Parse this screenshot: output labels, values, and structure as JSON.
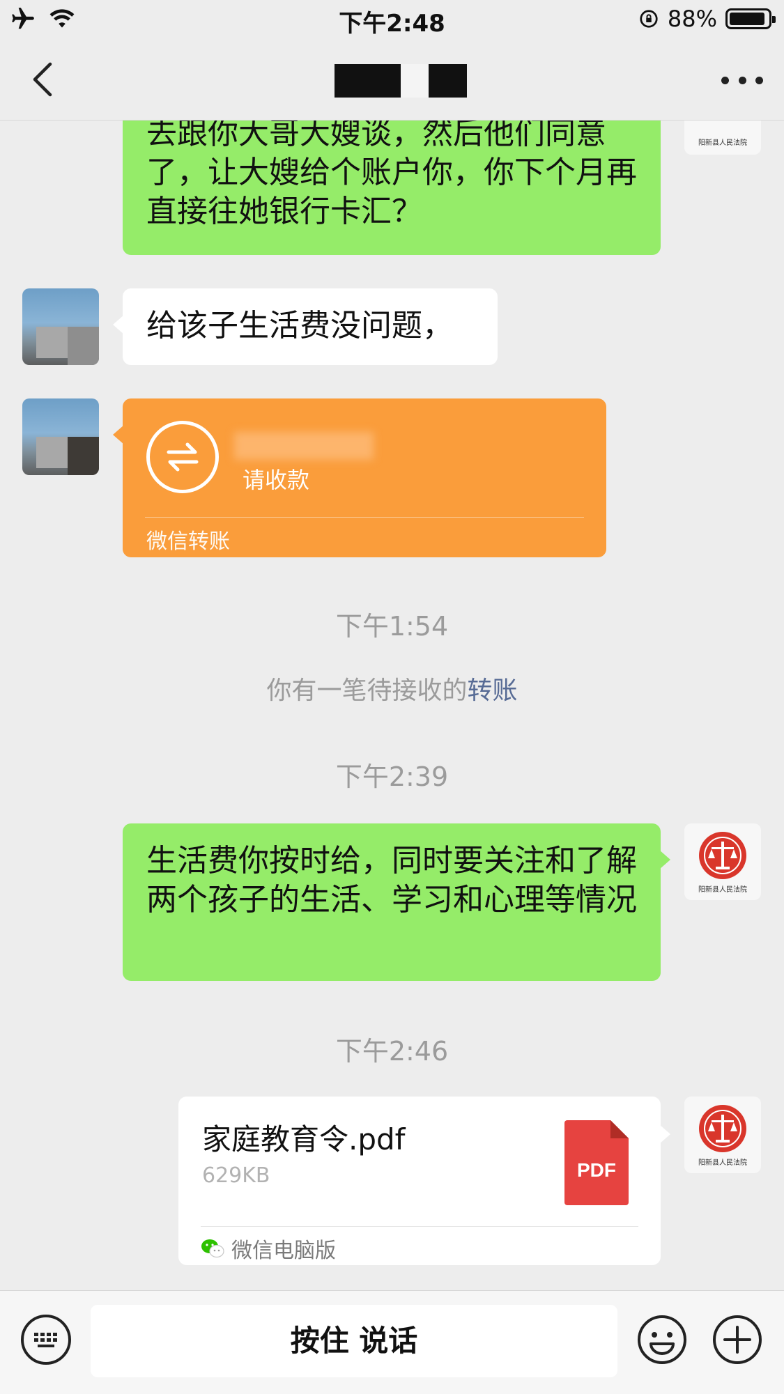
{
  "status_bar": {
    "time": "下午2:48",
    "battery": "88%"
  },
  "nav": {
    "title": ""
  },
  "messages": {
    "m1_text": "去跟你大哥大嫂谈，然后他们同意了，让大嫂给个账户你，你下个月再直接往她银行卡汇？",
    "m2_text": "给该子生活费没问题，",
    "transfer": {
      "label": "请收款",
      "footer": "微信转账"
    },
    "ts1": "下午1:54",
    "sys_text": "你有一笔待接收的",
    "sys_link": "转账",
    "ts2": "下午2:39",
    "m3_text": "生活费你按时给，同时要关注和了解两个孩子的生活、学习和心理等情况",
    "ts3": "下午2:46",
    "file": {
      "name": "家庭教育令.pdf",
      "size": "629KB",
      "icon_text": "PDF",
      "source": "微信电脑版"
    }
  },
  "avatars": {
    "court_label": "阳新县人民法院"
  },
  "input_bar": {
    "talk_label": "按住 说话"
  },
  "colors": {
    "green_bubble": "#95ec69",
    "transfer_orange": "#fa9d3b",
    "link_blue": "#576b95",
    "pdf_red": "#e64340"
  }
}
